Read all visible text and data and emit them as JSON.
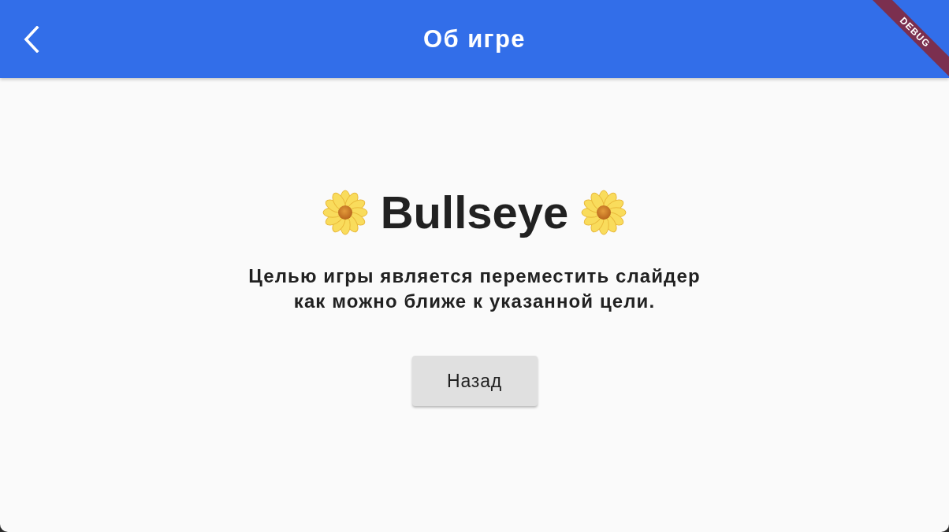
{
  "app_bar": {
    "title": "Об игре"
  },
  "debug_banner": {
    "label": "DEBUG"
  },
  "content": {
    "heading": "Bullseye",
    "description": "Целью игры является переместить слайдер как можно ближе к указанной цели."
  },
  "buttons": [
    {
      "label": "Назад"
    }
  ]
}
